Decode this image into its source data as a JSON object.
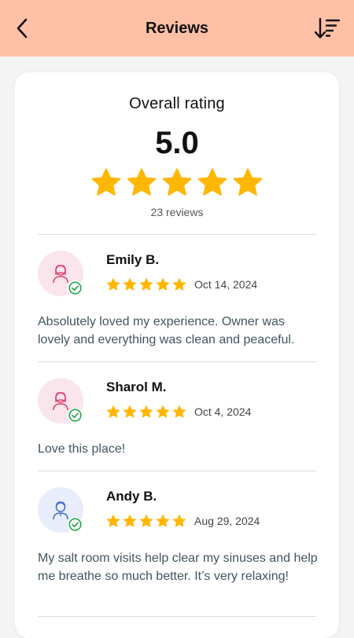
{
  "header": {
    "title": "Reviews",
    "back_icon": "chevron-left-icon",
    "sort_icon": "sort-descending-icon",
    "background": "#ffc0a6"
  },
  "summary": {
    "label": "Overall rating",
    "score": "5.0",
    "stars": 5,
    "count": "23 reviews",
    "star_color": "#ffb703"
  },
  "reviews": [
    {
      "name": "Emily B.",
      "stars": 5,
      "date": "Oct 14, 2024",
      "text": "Absolutely loved my experience. Owner was lovely and everything was clean and peaceful.",
      "avatar": "woman-icon",
      "avatar_color": "#fbe5ec",
      "verified": true
    },
    {
      "name": "Sharol M.",
      "stars": 5,
      "date": "Oct 4, 2024",
      "text": "Love this place!",
      "avatar": "woman-icon",
      "avatar_color": "#fbe5ec",
      "verified": true
    },
    {
      "name": "Andy B.",
      "stars": 5,
      "date": "Aug 29, 2024",
      "text": "My salt room visits help clear my sinuses and help me breathe so much better. It’s very relaxing!",
      "avatar": "man-icon",
      "avatar_color": "#e8ecfb",
      "verified": true
    }
  ]
}
